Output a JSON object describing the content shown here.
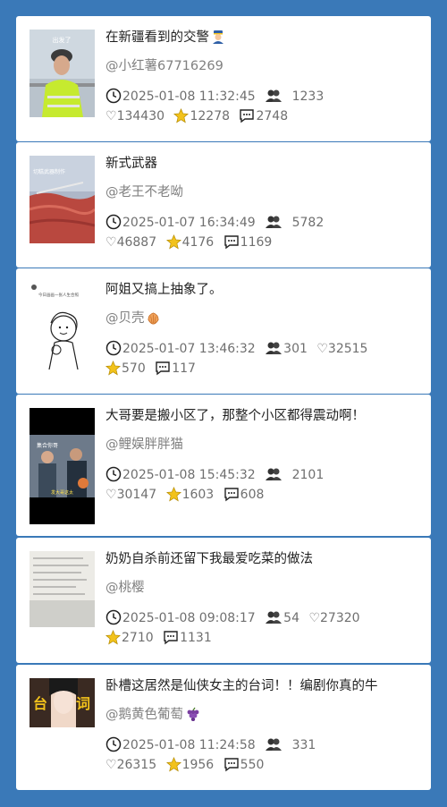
{
  "posts": [
    {
      "title": "在新疆看到的交警",
      "title_icon": "police-officer-icon",
      "author": "@小红薯67716269",
      "author_icon": "",
      "time": "2025-01-08 11:32:45",
      "shares": "",
      "likes": "1233",
      "views": "134430",
      "favorites": "12278",
      "comments": "2748",
      "thumb_text": [
        "出发了"
      ]
    },
    {
      "title": "新式武器",
      "title_icon": "",
      "author": "@老王不老呦",
      "author_icon": "",
      "time": "2025-01-07 16:34:49",
      "shares": "",
      "likes": "5782",
      "views": "46887",
      "favorites": "4176",
      "comments": "1169",
      "thumb_text": [
        "切糕武器制作"
      ]
    },
    {
      "title": "阿姐又搞上抽象了。",
      "title_icon": "",
      "author": "@贝壳",
      "author_icon": "shell-icon",
      "time": "2025-01-07 13:46:32",
      "shares": "301",
      "likes": "",
      "views": "32515",
      "favorites": "570",
      "comments": "117",
      "thumb_text": [
        "今日画画一张人生合照"
      ]
    },
    {
      "title": "大哥要是搬小区了，那整个小区都得震动啊！",
      "title_icon": "",
      "author": "@鲤娱胖胖猫",
      "author_icon": "",
      "time": "2025-01-08 15:45:32",
      "shares": "",
      "likes": "2101",
      "views": "30147",
      "favorites": "1603",
      "comments": "608",
      "thumb_text": [
        "集合你哥",
        "发大哥这太"
      ]
    },
    {
      "title": "奶奶自杀前还留下我最爱吃菜的做法",
      "title_icon": "",
      "author": "@桃樱",
      "author_icon": "",
      "time": "2025-01-08 09:08:17",
      "shares": "54",
      "likes": "",
      "views": "27320",
      "favorites": "2710",
      "comments": "1131",
      "thumb_text": []
    },
    {
      "title": "卧槽这居然是仙侠女主的台词！！编剧你真的牛",
      "title_icon": "",
      "author": "@鹅黄色葡萄",
      "author_icon": "grape-icon",
      "time": "2025-01-08 11:24:58",
      "shares": "",
      "likes": "331",
      "views": "26315",
      "favorites": "1956",
      "comments": "550",
      "thumb_text": [
        "台",
        "词"
      ]
    }
  ],
  "colors": {
    "background": "#3a79b8",
    "star": "#f2c21b",
    "card": "#ffffff"
  }
}
